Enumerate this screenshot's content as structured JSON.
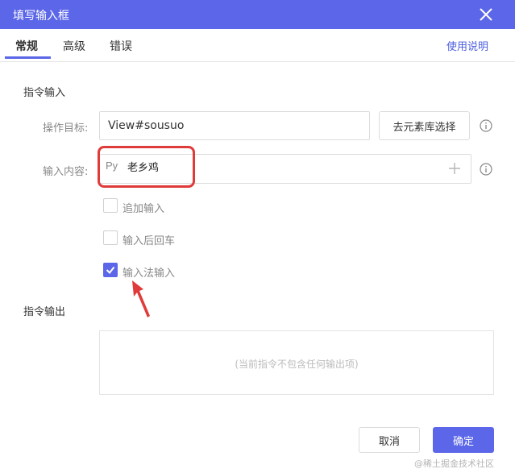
{
  "window": {
    "title": "填写输入框"
  },
  "tabs": [
    {
      "label": "常规",
      "active": true
    },
    {
      "label": "高级",
      "active": false
    },
    {
      "label": "错误",
      "active": false
    }
  ],
  "help_link": "使用说明",
  "command_input": {
    "section_title": "指令输入",
    "target": {
      "label": "操作目标:",
      "value": "View#sousuo",
      "button": "去元素库选择"
    },
    "content": {
      "label": "输入内容:",
      "icon_text": "Py",
      "value": "老乡鸡"
    },
    "options": [
      {
        "label": "追加输入",
        "checked": false
      },
      {
        "label": "输入后回车",
        "checked": false
      },
      {
        "label": "输入法输入",
        "checked": true
      }
    ]
  },
  "command_output": {
    "section_title": "指令输出",
    "empty_text": "(当前指令不包含任何输出项)"
  },
  "footer": {
    "cancel": "取消",
    "confirm": "确定"
  },
  "watermark": "@稀土掘金技术社区",
  "colors": {
    "accent": "#5b67e8",
    "annotation": "#e03b3b"
  },
  "icons": [
    "close-icon",
    "info-icon",
    "plus-icon",
    "check-icon",
    "annotation-arrow"
  ]
}
